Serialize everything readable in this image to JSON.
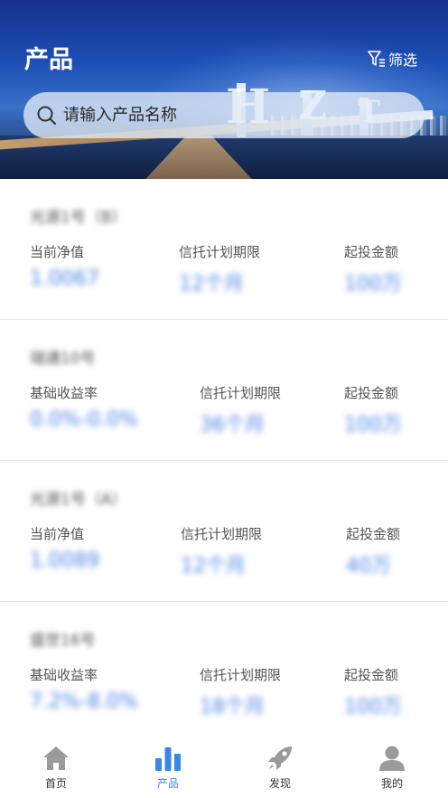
{
  "header": {
    "title": "产品",
    "filter_label": "筛选",
    "search_placeholder": "请输入产品名称",
    "watermark_letters": [
      "H",
      "Z",
      "T"
    ]
  },
  "products": [
    {
      "name": "光源1号（B）",
      "col1_label": "当前净值",
      "col1_value": "1.0067",
      "col2_label": "信托计划期限",
      "col2_value": "12个月",
      "col3_label": "起投金额",
      "col3_value": "100万"
    },
    {
      "name": "瑞通10号",
      "col1_label": "基础收益率",
      "col1_value": "0.0%-0.0%",
      "col2_label": "信托计划期限",
      "col2_value": "36个月",
      "col3_label": "起投金额",
      "col3_value": "100万"
    },
    {
      "name": "光源1号（A）",
      "col1_label": "当前净值",
      "col1_value": "1.0089",
      "col2_label": "信托计划期限",
      "col2_value": "12个月",
      "col3_label": "起投金额",
      "col3_value": "40万"
    },
    {
      "name": "盛世16号",
      "col1_label": "基础收益率",
      "col1_value": "7.2%-8.0%",
      "col2_label": "信托计划期限",
      "col2_value": "18个月",
      "col3_label": "起投金额",
      "col3_value": "100万"
    }
  ],
  "tabbar": [
    {
      "label": "首页",
      "icon": "home-icon",
      "active": false
    },
    {
      "label": "产品",
      "icon": "bar-chart-icon",
      "active": true
    },
    {
      "label": "发现",
      "icon": "rocket-icon",
      "active": false
    },
    {
      "label": "我的",
      "icon": "user-icon",
      "active": false
    }
  ],
  "colors": {
    "accent": "#3a86e8",
    "value_blue": "#4a82e6",
    "inactive_icon": "#9a9a9a"
  }
}
